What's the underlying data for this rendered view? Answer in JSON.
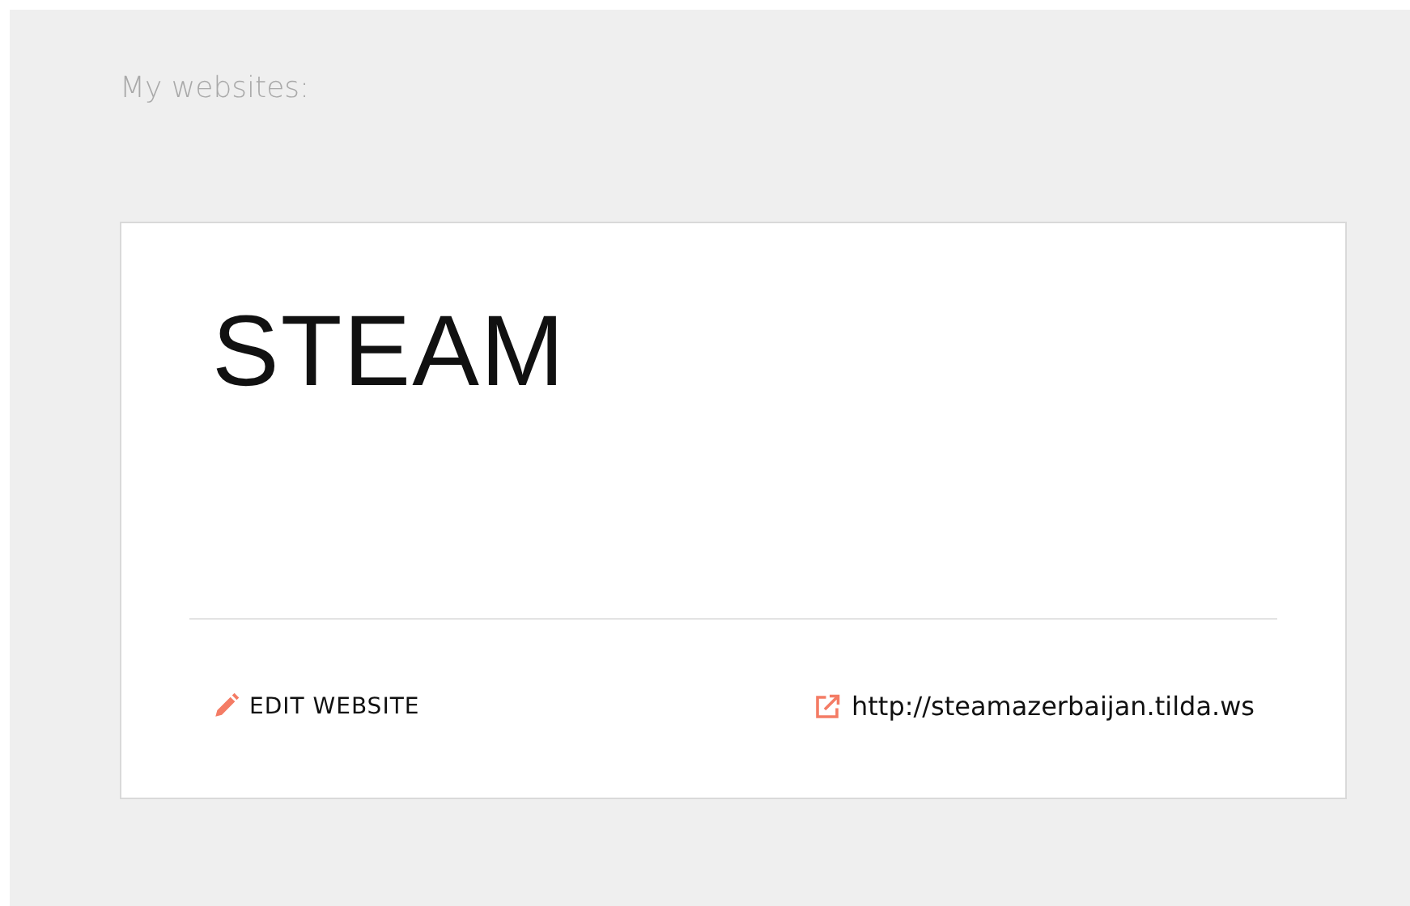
{
  "heading": "My websites:",
  "websites": [
    {
      "title": "STEAM",
      "edit_label": "EDIT WEBSITE",
      "url": "http://steamazerbaijan.tilda.ws"
    }
  ]
}
